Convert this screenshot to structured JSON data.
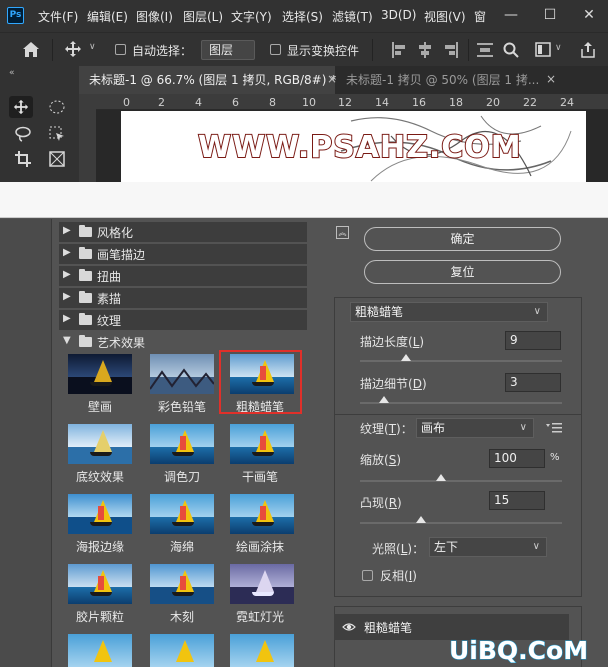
{
  "app": {
    "logo": "Ps"
  },
  "menu": {
    "items": [
      "文件(F)",
      "编辑(E)",
      "图像(I)",
      "图层(L)",
      "文字(Y)",
      "选择(S)",
      "滤镜(T)",
      "3D(D)",
      "视图(V)",
      "窗"
    ],
    "window_controls": [
      "—",
      "☐",
      "✕"
    ]
  },
  "options_bar": {
    "auto_select_label": "自动选择：",
    "auto_select_value": "图层",
    "show_transform_label": "显示变换控件"
  },
  "tabs": [
    {
      "label": "未标题-1 @ 66.7% (图层 1 拷贝, RGB/8#) *",
      "close": "×",
      "active": true
    },
    {
      "label": "未标题-1 拷贝 @ 50% (图层 1 拷...",
      "close": "×",
      "active": false
    }
  ],
  "ruler": {
    "ticks": [
      "0",
      "2",
      "4",
      "6",
      "8",
      "10",
      "12",
      "14",
      "16",
      "18",
      "20",
      "22",
      "24"
    ]
  },
  "canvas": {
    "watermark": "WWW.PSAHZ.COM"
  },
  "gallery": {
    "categories": [
      {
        "label": "风格化",
        "expanded": false
      },
      {
        "label": "画笔描边",
        "expanded": false
      },
      {
        "label": "扭曲",
        "expanded": false
      },
      {
        "label": "素描",
        "expanded": false
      },
      {
        "label": "纹理",
        "expanded": false
      },
      {
        "label": "艺术效果",
        "expanded": true
      }
    ],
    "filters": [
      "壁画",
      "彩色铅笔",
      "粗糙蜡笔",
      "底纹效果",
      "调色刀",
      "干画笔",
      "海报边缘",
      "海绵",
      "绘画涂抹",
      "胶片颗粒",
      "木刻",
      "霓虹灯光"
    ],
    "selected": "粗糙蜡笔"
  },
  "buttons": {
    "ok": "确定",
    "reset": "复位"
  },
  "settings": {
    "filter_name": "粗糙蜡笔",
    "stroke_length_label": "描边长度(",
    "stroke_length_key": "L",
    "stroke_length_value": "9",
    "stroke_length_fraction": 0.23,
    "stroke_detail_label": "描边细节(",
    "stroke_detail_key": "D",
    "stroke_detail_value": "3",
    "stroke_detail_fraction": 0.12,
    "texture_label": "纹理(",
    "texture_key": "T",
    "texture_value": "画布",
    "scaling_label": "缩放(",
    "scaling_key": "S",
    "scaling_value": "100",
    "scaling_unit": "%",
    "scaling_fraction": 0.4,
    "relief_label": "凸现(",
    "relief_key": "R",
    "relief_value": "15",
    "relief_fraction": 0.3,
    "light_label": "光照(",
    "light_key": "L",
    "light_value": "左下",
    "invert_label": "反相(",
    "invert_key": "I",
    "invert_checked": false,
    "close_paren": ")",
    "colon": "："
  },
  "effect_layers": [
    {
      "name": "粗糙蜡笔",
      "visible": true
    }
  ],
  "site_logo": "UiBQ.CoM",
  "colors": {
    "accent": "#31a8ff",
    "selection": "#e0302a",
    "panel": "#535353",
    "chrome": "#323232"
  }
}
